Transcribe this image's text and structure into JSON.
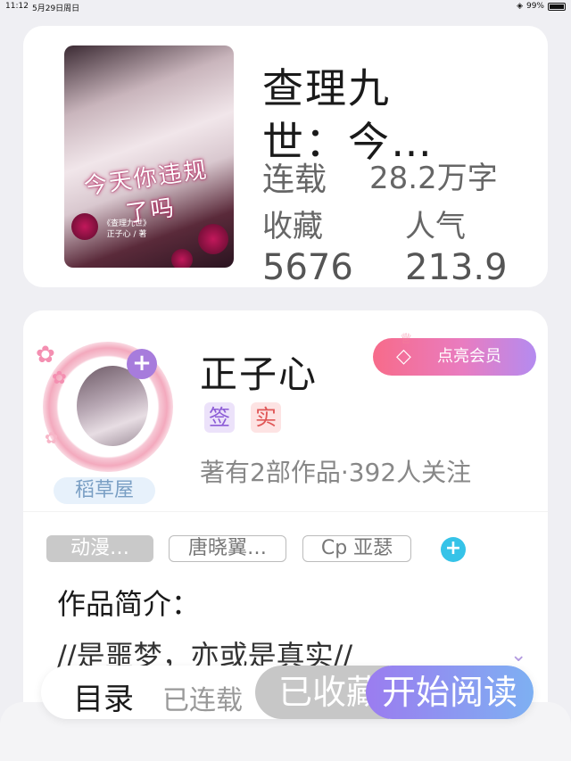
{
  "status_bar": {
    "time": "11:12",
    "date": "5月29日周日",
    "wifi": "wifi-icon",
    "battery": "99%"
  },
  "book": {
    "title_line1": "查理九",
    "title_line2": "世：今…",
    "serial_status": "连载",
    "word_count": "28.2万字",
    "favorites_label": "收藏",
    "favorites_value": "5676",
    "popularity_label": "人气",
    "popularity_value": "213.9",
    "cover_title": "今天你违规了吗",
    "cover_author_line1": "《查理九世》",
    "cover_author_line2": "正子心 / 著"
  },
  "author": {
    "name": "正子心",
    "badge_sign": "签",
    "badge_real": "实",
    "meta": "著有2部作品·392人关注",
    "avatar_tag": "稻草屋",
    "vip_button": "点亮会员"
  },
  "tags": [
    "动漫…",
    "唐晓翼…",
    "Cp 亚瑟"
  ],
  "intro": {
    "title": "作品简介：",
    "text": "//是噩梦，亦或是真实//"
  },
  "action_bar": {
    "toc": "目录",
    "status": "已连载",
    "collected": "已收藏",
    "read": "开始阅读"
  },
  "colors": {
    "accent_purple": "#a77cdc",
    "vip_gradient_start": "#f76b8a",
    "vip_gradient_end": "#b48bf0",
    "read_gradient_start": "#9b7cf0",
    "read_gradient_end": "#7eb0f2",
    "tag_add": "#36c3e8"
  }
}
